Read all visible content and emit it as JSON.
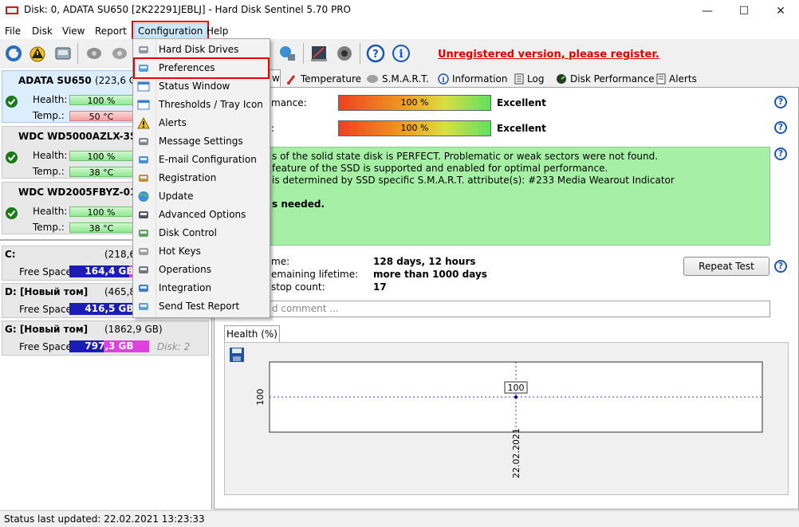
{
  "window": {
    "title": "Disk: 0, ADATA SU650 [2K22291JEBLJ]  -  Hard Disk Sentinel 5.70 PRO",
    "controls": {
      "minimize": "—",
      "maximize": "☐",
      "close": "✕"
    }
  },
  "menubar": [
    {
      "key": "file",
      "label": "File"
    },
    {
      "key": "disk",
      "label": "Disk"
    },
    {
      "key": "view",
      "label": "View"
    },
    {
      "key": "report",
      "label": "Report"
    },
    {
      "key": "configuration",
      "label": "Configuration"
    },
    {
      "key": "help",
      "label": "Help"
    }
  ],
  "toolbar": {
    "unregistered": "Unregistered version, please register."
  },
  "dropdown": {
    "items": [
      {
        "label": "Hard Disk Drives",
        "icon": "hdd-icon"
      },
      {
        "label": "Preferences",
        "icon": "preferences-icon"
      },
      {
        "label": "Status Window",
        "icon": "window-icon"
      },
      {
        "label": "Thresholds / Tray Icon",
        "icon": "thresholds-icon"
      },
      {
        "label": "Alerts",
        "icon": "warning-icon"
      },
      {
        "label": "Message Settings",
        "icon": "message-icon"
      },
      {
        "label": "E-mail Configuration",
        "icon": "email-icon"
      },
      {
        "label": "Registration",
        "icon": "registration-icon"
      },
      {
        "label": "Update",
        "icon": "globe-icon"
      },
      {
        "label": "Advanced Options",
        "icon": "advanced-icon"
      },
      {
        "label": "Disk Control",
        "icon": "disk-control-icon"
      },
      {
        "label": "Hot Keys",
        "icon": "keyboard-icon"
      },
      {
        "label": "Operations",
        "icon": "gears-icon"
      },
      {
        "label": "Integration",
        "icon": "integration-icon"
      },
      {
        "label": "Send Test Report",
        "icon": "send-report-icon"
      }
    ]
  },
  "disks": [
    {
      "name": "ADATA SU650",
      "capacity": "(223,6 GB)",
      "health_label": "Health:",
      "health": "100 %",
      "temp_label": "Temp.:",
      "temp": "50 °C"
    },
    {
      "name": "WDC WD5000AZLX-35K2",
      "capacity": "",
      "health_label": "Health:",
      "health": "100 %",
      "temp_label": "Temp.:",
      "temp": "38 °C"
    },
    {
      "name": "WDC WD2005FBYZ-01YCI",
      "capacity": "",
      "health_label": "Health:",
      "health": "100 %",
      "temp_label": "Temp.:",
      "temp": "38 °C"
    }
  ],
  "volumes": [
    {
      "name": "C:",
      "capacity": "(218,6",
      "free_label": "Free Space",
      "free": "164,4 GB",
      "free_fraction": 0.75,
      "disk": ""
    },
    {
      "name": "D: [Новый том]",
      "capacity": "(465,8",
      "free_label": "Free Space",
      "free": "416,5 GB",
      "free_fraction": 0.89,
      "disk": ""
    },
    {
      "name": "G: [Новый том]",
      "capacity": "(1862,9 GB)",
      "free_label": "Free Space",
      "free": "797,3 GB",
      "free_fraction": 0.43,
      "disk": "Disk: 2"
    }
  ],
  "tabs": [
    {
      "label": "w",
      "icon": "",
      "active": true
    },
    {
      "label": "Temperature",
      "icon": "thermometer-icon"
    },
    {
      "label": "S.M.A.R.T.",
      "icon": "smart-icon"
    },
    {
      "label": "Information",
      "icon": "info-icon"
    },
    {
      "label": "Log",
      "icon": "log-icon"
    },
    {
      "label": "Disk Performance",
      "icon": "performance-icon"
    },
    {
      "label": "Alerts",
      "icon": "alerts-icon"
    }
  ],
  "overview": {
    "performance_label": "mance:",
    "performance_value": "100 %",
    "performance_rating": "Excellent",
    "health_label": ":",
    "health_value": "100 %",
    "health_rating": "Excellent",
    "status_lines": [
      "s of the solid state disk is PERFECT. Problematic or weak sectors were not found.",
      "feature of the SSD is supported and enabled for optimal performance.",
      "is determined by SSD specific S.M.A.R.T. attribute(s):  #233 Media Wearout Indicator",
      "",
      "s needed."
    ],
    "power_on_label": "me:",
    "power_on_value": "128 days, 12 hours",
    "lifetime_label": "emaining lifetime:",
    "lifetime_value": "more than 1000 days",
    "startstop_label": "stop count:",
    "startstop_value": "17",
    "repeat_test": "Repeat Test",
    "comment_placeholder": "d comment ..."
  },
  "chart_tab": "Health (%)",
  "chart_data": {
    "type": "line",
    "x": [
      "22.02.2021"
    ],
    "y": [
      100
    ],
    "ylabel": "100",
    "point_label": "100"
  },
  "statusbar": "Status last updated: 22.02.2021 13:23:33",
  "colors": {
    "accent_red": "#e00000",
    "status_green": "#a6f0a6",
    "volume_blue": "#1c1cb8",
    "volume_magenta": "#e040e0"
  }
}
